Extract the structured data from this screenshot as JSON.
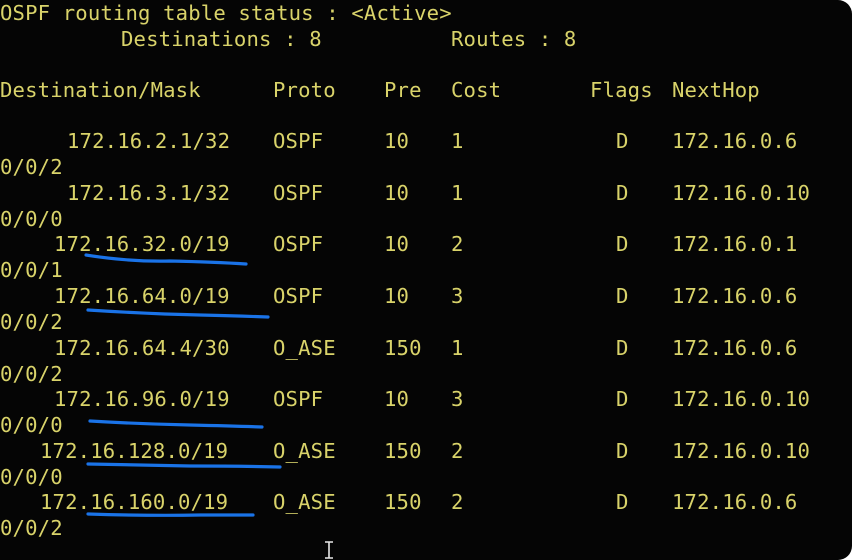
{
  "header": {
    "status_line": "OSPF routing table status : <Active>",
    "destinations_label": "Destinations : 8",
    "routes_label": "Routes : 8"
  },
  "columns": {
    "destination": "Destination/Mask",
    "proto": "Proto",
    "pre": "Pre",
    "cost": "Cost",
    "flags": "Flags",
    "nexthop": "NextHop"
  },
  "rows": [
    {
      "destination": "172.16.2.1/32",
      "proto": "OSPF",
      "pre": "10",
      "cost": "1",
      "flags": "D",
      "nexthop": "172.16.0.6",
      "interface": "0/0/2"
    },
    {
      "destination": "172.16.3.1/32",
      "proto": "OSPF",
      "pre": "10",
      "cost": "1",
      "flags": "D",
      "nexthop": "172.16.0.10",
      "interface": "0/0/0"
    },
    {
      "destination": "172.16.32.0/19",
      "proto": "OSPF",
      "pre": "10",
      "cost": "2",
      "flags": "D",
      "nexthop": "172.16.0.1",
      "interface": "0/0/1"
    },
    {
      "destination": "172.16.64.0/19",
      "proto": "OSPF",
      "pre": "10",
      "cost": "3",
      "flags": "D",
      "nexthop": "172.16.0.6",
      "interface": "0/0/2"
    },
    {
      "destination": "172.16.64.4/30",
      "proto": "O_ASE",
      "pre": "150",
      "cost": "1",
      "flags": "D",
      "nexthop": "172.16.0.6",
      "interface": "0/0/2"
    },
    {
      "destination": "172.16.96.0/19",
      "proto": "OSPF",
      "pre": "10",
      "cost": "3",
      "flags": "D",
      "nexthop": "172.16.0.10",
      "interface": "0/0/0"
    },
    {
      "destination": "172.16.128.0/19",
      "proto": "O_ASE",
      "pre": "150",
      "cost": "2",
      "flags": "D",
      "nexthop": "172.16.0.10",
      "interface": "0/0/0"
    },
    {
      "destination": "172.16.160.0/19",
      "proto": "O_ASE",
      "pre": "150",
      "cost": "2",
      "flags": "D",
      "nexthop": "172.16.0.6",
      "interface": "0/0/2"
    }
  ],
  "annotation_color": "#1a73e8",
  "text_color": "#d9d36a",
  "background_color": "#050505",
  "cursor_icon": "text-cursor-icon"
}
